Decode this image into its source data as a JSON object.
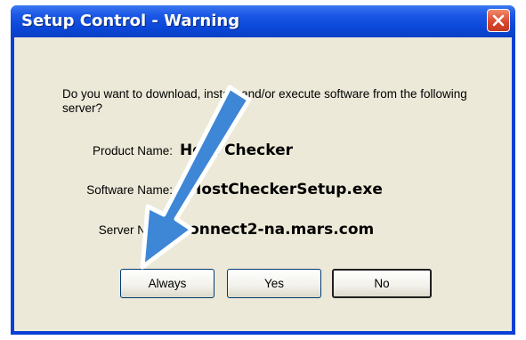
{
  "dialog": {
    "title": "Setup Control - Warning",
    "question": "Do you want to downlo‌ad, install, and/or execute software from the following server?",
    "rows": [
      {
        "label": "Product Name:",
        "value": "Host Checker"
      },
      {
        "label": "Software Name:",
        "value": "sHostCheckerSetup.exe"
      },
      {
        "label": "Server Name:",
        "value": "connect2-na.mars.com"
      }
    ],
    "buttons": {
      "always": "Always",
      "yes": "Yes",
      "no": "No"
    }
  },
  "annotation": {
    "arrow_color": "#3e86d6",
    "arrow_target": "always-button"
  }
}
